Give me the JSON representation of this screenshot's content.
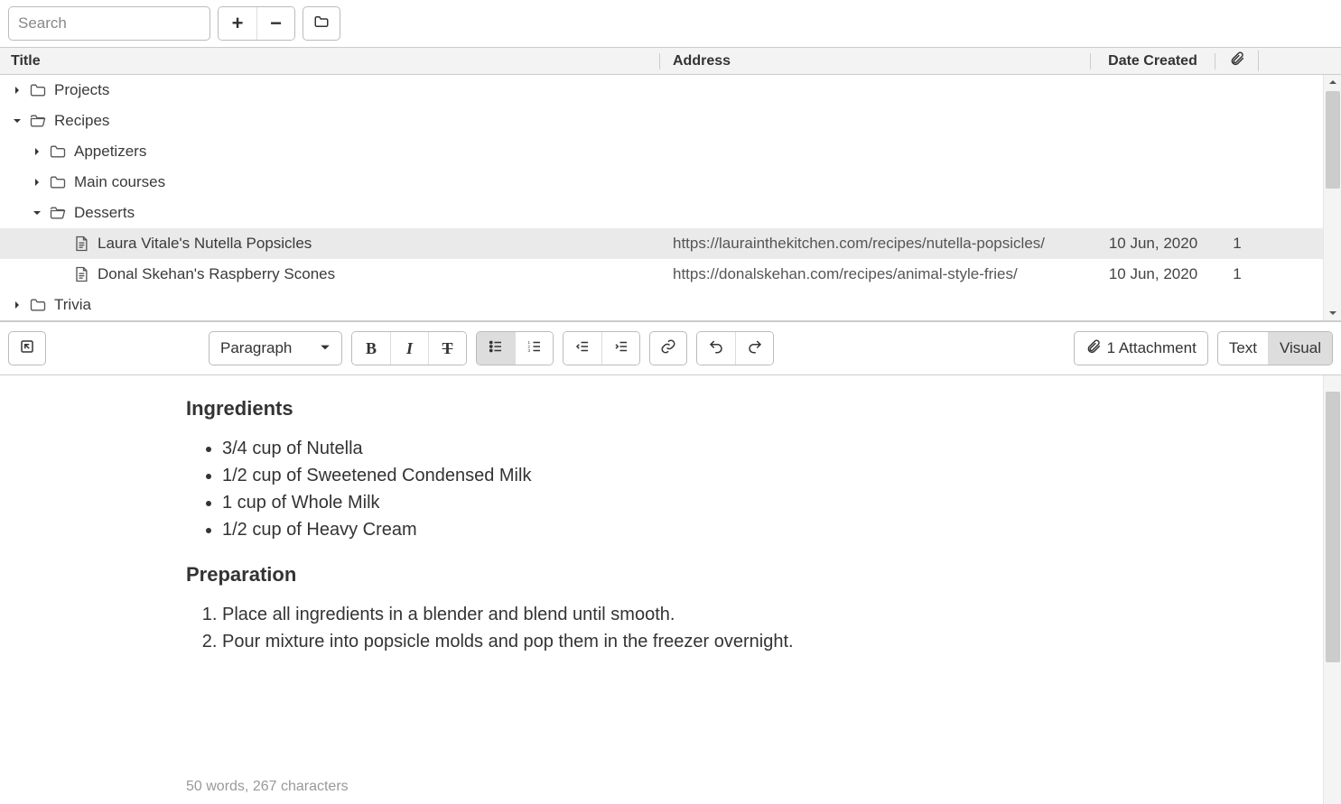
{
  "toolbar": {
    "search_placeholder": "Search",
    "plus": "+",
    "minus": "−"
  },
  "headers": {
    "title": "Title",
    "address": "Address",
    "date": "Date Created"
  },
  "tree": [
    {
      "label": "Projects",
      "kind": "folder",
      "expanded": false,
      "indent": 1
    },
    {
      "label": "Recipes",
      "kind": "folder-open",
      "expanded": true,
      "indent": 1
    },
    {
      "label": "Appetizers",
      "kind": "folder",
      "expanded": false,
      "indent": 2
    },
    {
      "label": "Main courses",
      "kind": "folder",
      "expanded": false,
      "indent": 2
    },
    {
      "label": "Desserts",
      "kind": "folder-open",
      "expanded": true,
      "indent": 2
    },
    {
      "label": "Laura Vitale's Nutella Popsicles",
      "kind": "page",
      "indent": 3,
      "selected": true,
      "address": "https://laurainthekitchen.com/recipes/nutella-popsicles/",
      "date": "10 Jun, 2020",
      "att": "1"
    },
    {
      "label": "Donal Skehan's Raspberry Scones",
      "kind": "page",
      "indent": 3,
      "address": "https://donalskehan.com/recipes/animal-style-fries/",
      "date": "10 Jun, 2020",
      "att": "1"
    },
    {
      "label": "Trivia",
      "kind": "folder",
      "expanded": false,
      "indent": 1
    }
  ],
  "editor_toolbar": {
    "para": "Paragraph",
    "attach": "1 Attachment",
    "mode_text": "Text",
    "mode_visual": "Visual"
  },
  "doc": {
    "h_ingredients": "Ingredients",
    "ingredients": [
      "3/4 cup of Nutella",
      "1/2 cup of Sweetened Condensed Milk",
      "1 cup of Whole Milk",
      "1/2 cup of Heavy Cream"
    ],
    "h_prep": "Preparation",
    "steps": [
      "Place all ingredients in a blender and blend until smooth.",
      "Pour mixture into popsicle molds and pop them in the freezer overnight."
    ]
  },
  "status": "50 words, 267 characters"
}
